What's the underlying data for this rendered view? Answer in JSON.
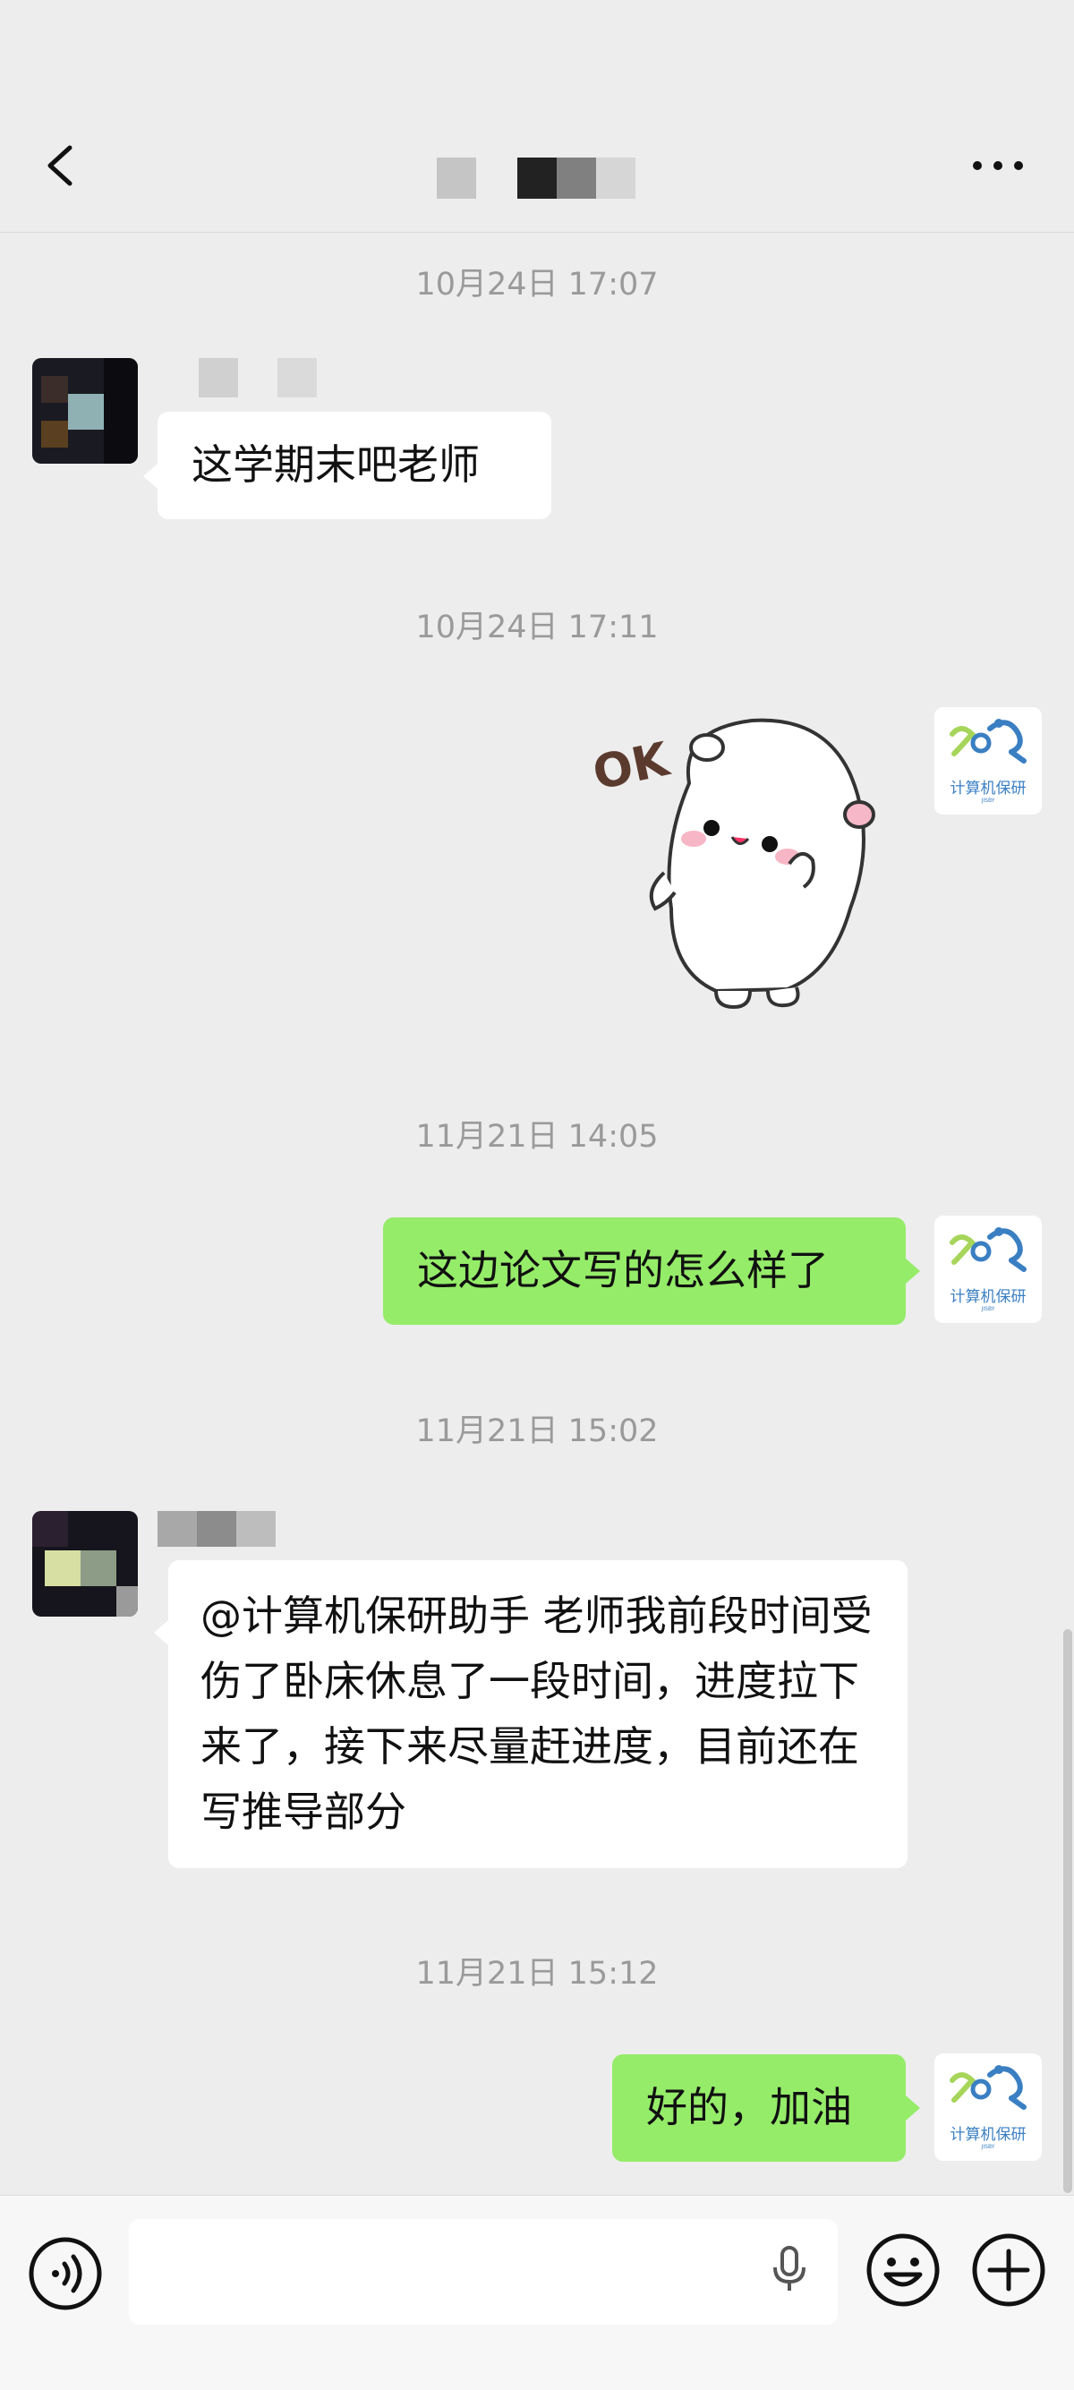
{
  "colors": {
    "background": "#ededed",
    "bubble_sent": "#95ec69",
    "bubble_received": "#ffffff",
    "timestamp": "#9a9a9a",
    "logo_blue": "#3a7fc2",
    "logo_green": "#a6d55a"
  },
  "header": {
    "back_icon": "chevron-left-icon",
    "more_icon": "ellipsis-icon"
  },
  "messages": {
    "t1": "10月24日 17:07",
    "m1": "这学期末吧老师",
    "t2": "10月24日 17:11",
    "m2_sticker_text": "OK",
    "t3": "11月21日 14:05",
    "m3": "这边论文写的怎么样了",
    "t4": "11月21日 15:02",
    "m4": "@计算机保研助手  老师我前段时间受伤了卧床休息了一段时间，进度拉下来了，接下来尽量赶进度，目前还在写推导部分",
    "t5": "11月21日 15:12",
    "m5": "好的，加油"
  },
  "self_avatar": {
    "label": "计算机保研",
    "sub": "JISBY"
  },
  "input_bar": {
    "voice_icon": "voice-icon",
    "mic_icon": "microphone-icon",
    "emoji_icon": "emoji-icon",
    "plus_icon": "plus-icon",
    "placeholder": ""
  }
}
